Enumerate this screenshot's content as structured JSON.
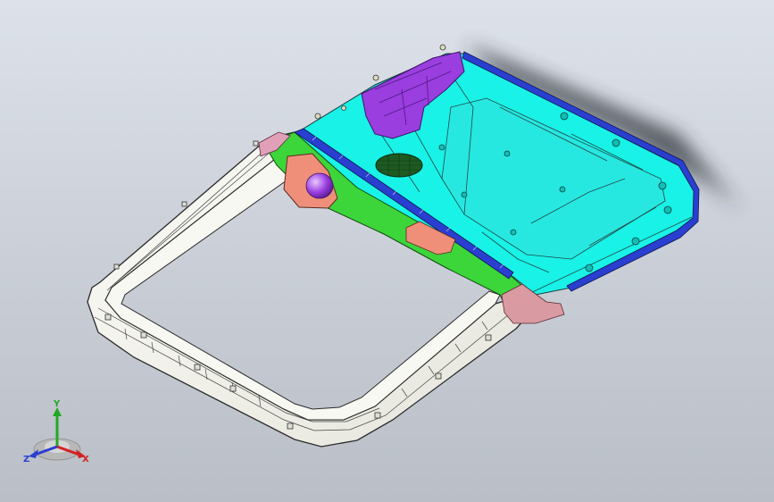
{
  "triad": {
    "x_label": "X",
    "y_label": "Y",
    "z_label": "Z",
    "colors": {
      "x": "#d42020",
      "y": "#22a822",
      "z": "#2a3fd0"
    }
  },
  "model_colors": {
    "frame_surface": "#f3f2ea",
    "frame_edge": "#2a2a2a",
    "housing_surface": "#19f2e6",
    "bracket_purple": "#9a3ee0",
    "rail_green": "#3dd63a",
    "rail_blue": "#2a3fd0",
    "salmon_part": "#ef8f7a",
    "background": "#d4d9e1"
  }
}
